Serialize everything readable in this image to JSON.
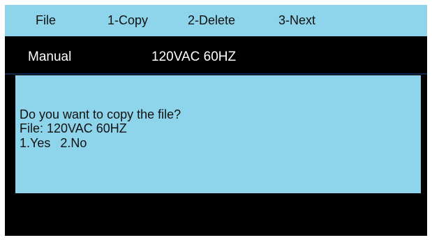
{
  "menu": {
    "file": "File",
    "copy": "1-Copy",
    "delete": "2-Delete",
    "next": "3-Next"
  },
  "status": {
    "mode": "Manual",
    "profile": "120VAC 60HZ"
  },
  "dialog": {
    "question": "Do you want to copy the file?",
    "file_line": "File: 120VAC 60HZ",
    "option_yes": "1.Yes",
    "option_no": "2.No"
  },
  "colors": {
    "panel_blue": "#8ed5ec",
    "background": "#000000",
    "text_dark": "#111111",
    "text_light": "#ffffff"
  }
}
